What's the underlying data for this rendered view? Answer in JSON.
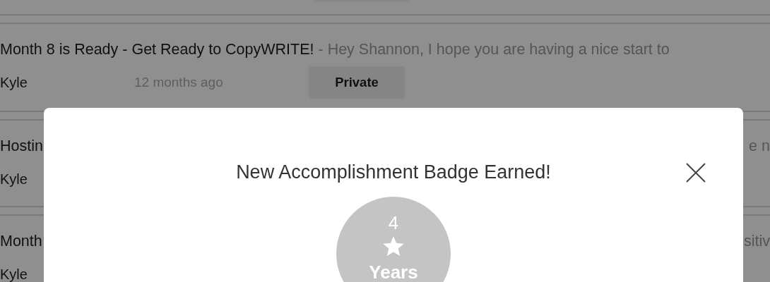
{
  "messages": [
    {
      "title": "Month 8 is Ready - Get Ready to CopyWRITE!",
      "preview": "- Hey Shannon, I hope you are having a nice start to",
      "author": "Kyle",
      "time": "12 months ago",
      "visibility": "Private"
    },
    {
      "title": "Hostin",
      "tail": "e n",
      "author": "Kyle"
    },
    {
      "title": "Month",
      "tail": "sitiv",
      "author": "Kyle"
    }
  ],
  "dialog": {
    "title": "New Accomplishment Badge Earned!",
    "badge": {
      "number": "4",
      "unit": "Years"
    }
  }
}
